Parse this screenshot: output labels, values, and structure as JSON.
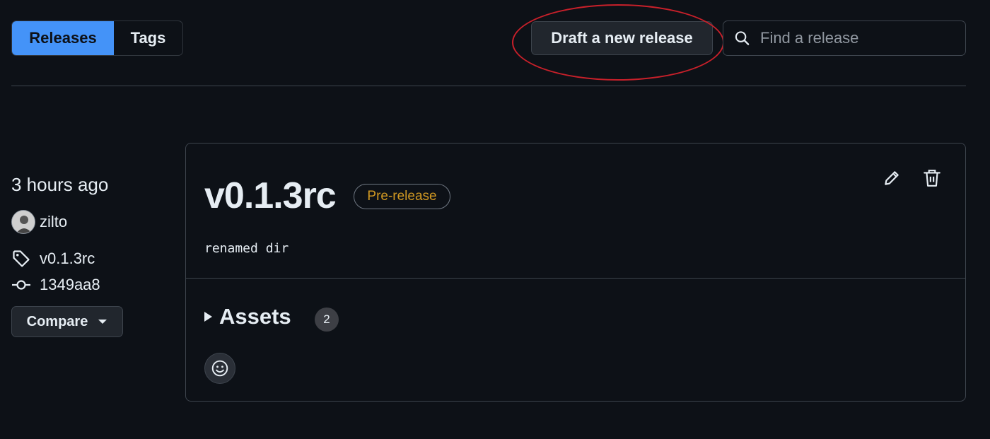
{
  "nav": {
    "releases_label": "Releases",
    "tags_label": "Tags"
  },
  "actions": {
    "draft_label": "Draft a new release"
  },
  "search": {
    "placeholder": "Find a release",
    "value": ""
  },
  "release": {
    "time_ago": "3 hours ago",
    "author": "zilto",
    "tag": "v0.1.3rc",
    "commit": "1349aa8",
    "compare_label": "Compare",
    "title": "v0.1.3rc",
    "badge": "Pre-release",
    "description": "renamed dir",
    "assets_label": "Assets",
    "assets_count": "2"
  },
  "colors": {
    "accent": "#4493f8",
    "badge_text": "#d29922",
    "highlight": "#c8202a",
    "background": "#0d1117"
  },
  "icons": [
    "search-icon",
    "tag-icon",
    "commit-icon",
    "chevron-down-icon",
    "pencil-icon",
    "trash-icon",
    "smiley-icon"
  ]
}
